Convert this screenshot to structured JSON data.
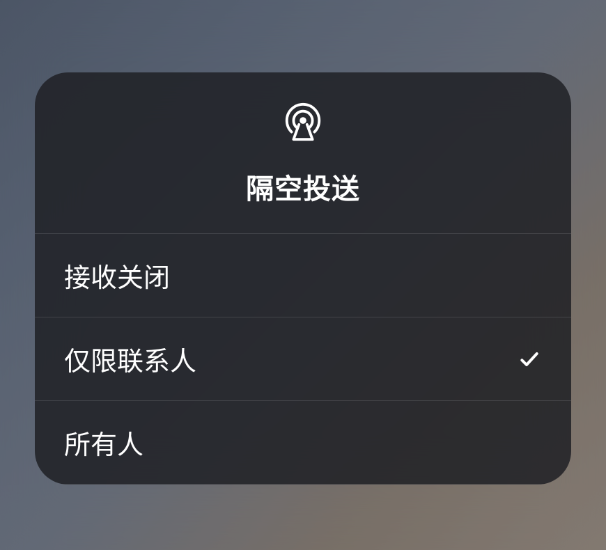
{
  "header": {
    "title": "隔空投送",
    "icon": "airdrop-icon"
  },
  "options": [
    {
      "label": "接收关闭",
      "selected": false
    },
    {
      "label": "仅限联系人",
      "selected": true
    },
    {
      "label": "所有人",
      "selected": false
    }
  ]
}
